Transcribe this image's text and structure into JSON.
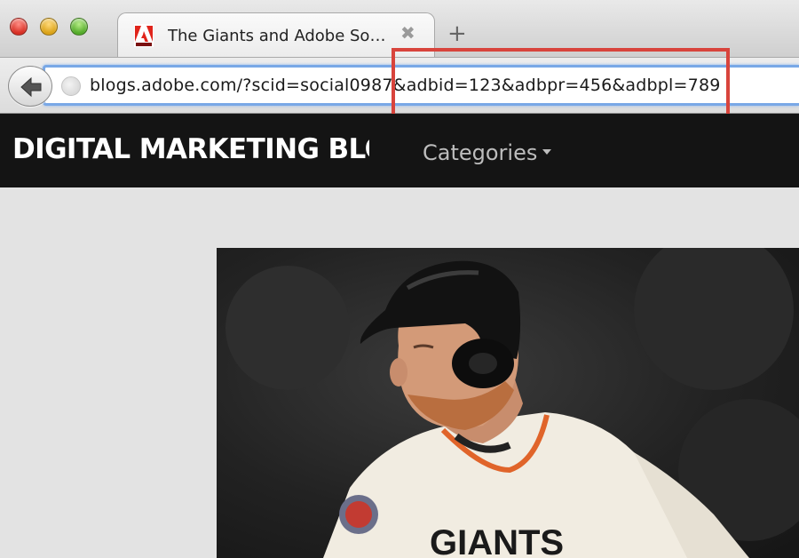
{
  "browser": {
    "tab": {
      "title": "The Giants and Adobe Soc…",
      "close_glyph": "✖",
      "favicon": "adobe-icon"
    },
    "new_tab_glyph": "+",
    "address_bar": {
      "url": "blogs.adobe.com/?scid=social0987&adbid=123&adbpr=456&adbpl=789"
    }
  },
  "site": {
    "brand": "DIGITAL MARKETING BLOG",
    "nav": {
      "categories_label": "Categories"
    }
  },
  "hero": {
    "image": "baseball-player-photo",
    "jersey_text": "GIANTS"
  },
  "colors": {
    "highlight": "#d8443c",
    "nav_bg": "#141414",
    "url_focus": "#79a8e6",
    "page_bg": "#e3e3e3"
  }
}
